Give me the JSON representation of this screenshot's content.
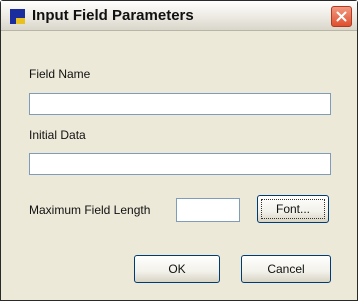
{
  "window": {
    "title": "Input Field Parameters"
  },
  "form": {
    "field_name_label": "Field Name",
    "field_name_value": "",
    "initial_data_label": "Initial Data",
    "initial_data_value": "",
    "max_length_label": "Maximum Field Length",
    "max_length_value": ""
  },
  "buttons": {
    "font": "Font...",
    "ok": "OK",
    "cancel": "Cancel"
  },
  "colors": {
    "window_bg": "#ece9d8",
    "close_button": "#df4f2e",
    "input_border": "#7f9db9",
    "button_border": "#003c74"
  },
  "icons": {
    "app": "app-window-icon",
    "close": "close-icon"
  }
}
